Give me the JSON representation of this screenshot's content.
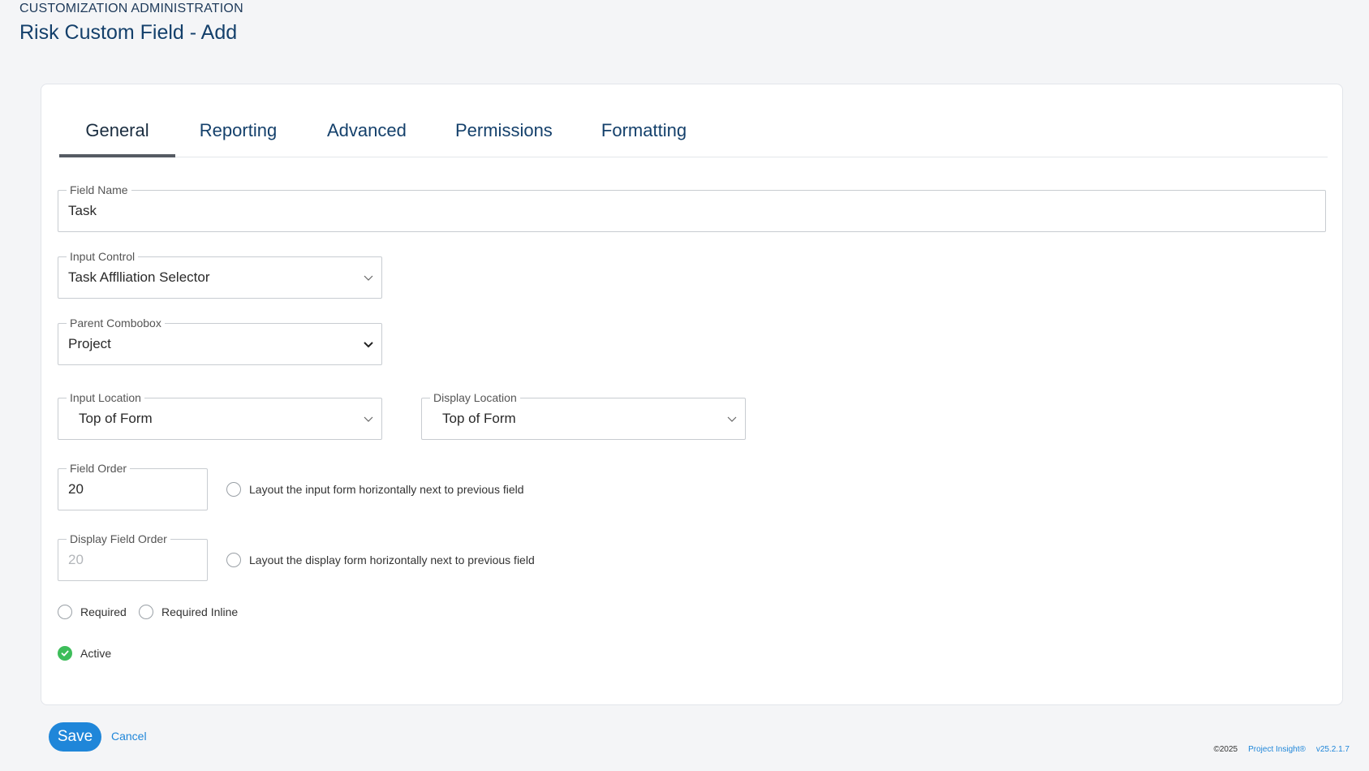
{
  "header": {
    "section": "CUSTOMIZATION ADMINISTRATION",
    "title": "Risk Custom Field - Add"
  },
  "tabs": [
    {
      "label": "General",
      "active": true
    },
    {
      "label": "Reporting",
      "active": false
    },
    {
      "label": "Advanced",
      "active": false
    },
    {
      "label": "Permissions",
      "active": false
    },
    {
      "label": "Formatting",
      "active": false
    }
  ],
  "form": {
    "field_name": {
      "label": "Field Name",
      "value": "Task"
    },
    "input_control": {
      "label": "Input Control",
      "value": "Task Afflliation Selector"
    },
    "parent_combobox": {
      "label": "Parent Combobox",
      "value": "Project"
    },
    "input_location": {
      "label": "Input Location",
      "value": "Top of Form"
    },
    "display_location": {
      "label": "Display Location",
      "value": "Top of Form"
    },
    "field_order": {
      "label": "Field Order",
      "value": "20"
    },
    "input_horizontal": {
      "label": "Layout the input form horizontally next to previous field",
      "checked": false
    },
    "display_field_order": {
      "label": "Display Field Order",
      "value": "20",
      "disabled": true
    },
    "display_horizontal": {
      "label": "Layout the display form horizontally next to previous field",
      "checked": false
    },
    "required": {
      "label": "Required",
      "checked": false
    },
    "required_inline": {
      "label": "Required Inline",
      "checked": false
    },
    "active": {
      "label": "Active",
      "checked": true
    }
  },
  "actions": {
    "save_label": "Save",
    "cancel_label": "Cancel"
  },
  "footer": {
    "copyright": "©2025",
    "brand": "Project Insight®",
    "version": "v25.2.1.7"
  },
  "colors": {
    "primary": "#1f86d9",
    "title": "#14406b",
    "active_check": "#3dbd5a"
  }
}
